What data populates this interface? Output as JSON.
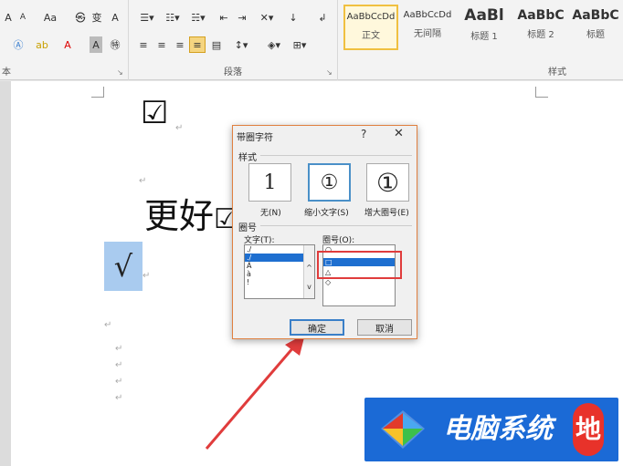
{
  "ribbon": {
    "font_tools_row1": [
      "A",
      "A",
      "Aa",
      "变",
      "A"
    ],
    "font_group_label": "本",
    "paragraph_group_label": "段落",
    "styles_group_label": "样式",
    "styles": [
      {
        "preview": "AaBbCcDd",
        "label": "正文"
      },
      {
        "preview": "AaBbCcDd",
        "label": "无间隔"
      },
      {
        "preview": "AaBl",
        "label": "标题 1"
      },
      {
        "preview": "AaBbC",
        "label": "标题 2"
      },
      {
        "preview": "AaBbC",
        "label": "标题"
      }
    ]
  },
  "document": {
    "checkbox_symbol": "☑",
    "text_line": "更好",
    "text_line_tail": "☑",
    "selected_char": "√",
    "para_mark": "↵"
  },
  "dialog": {
    "title": "带圈字符",
    "help": "?",
    "close": "✕",
    "style_section": "样式",
    "style_options": [
      {
        "preview": "1",
        "label": "无(N)"
      },
      {
        "preview": "①",
        "label": "缩小文字(S)"
      },
      {
        "preview": "①",
        "label": "增大圈号(E)"
      }
    ],
    "enclosure_section": "圈号",
    "text_label": "文字(T):",
    "text_items": [
      "./",
      "./",
      "Â",
      "à",
      "!"
    ],
    "circle_label": "圈号(O):",
    "circle_items": [
      "○",
      "□",
      "△",
      "◇"
    ],
    "ok": "确定",
    "cancel": "取消"
  },
  "watermark": {
    "text": "电脑系统",
    "badge": "地"
  }
}
